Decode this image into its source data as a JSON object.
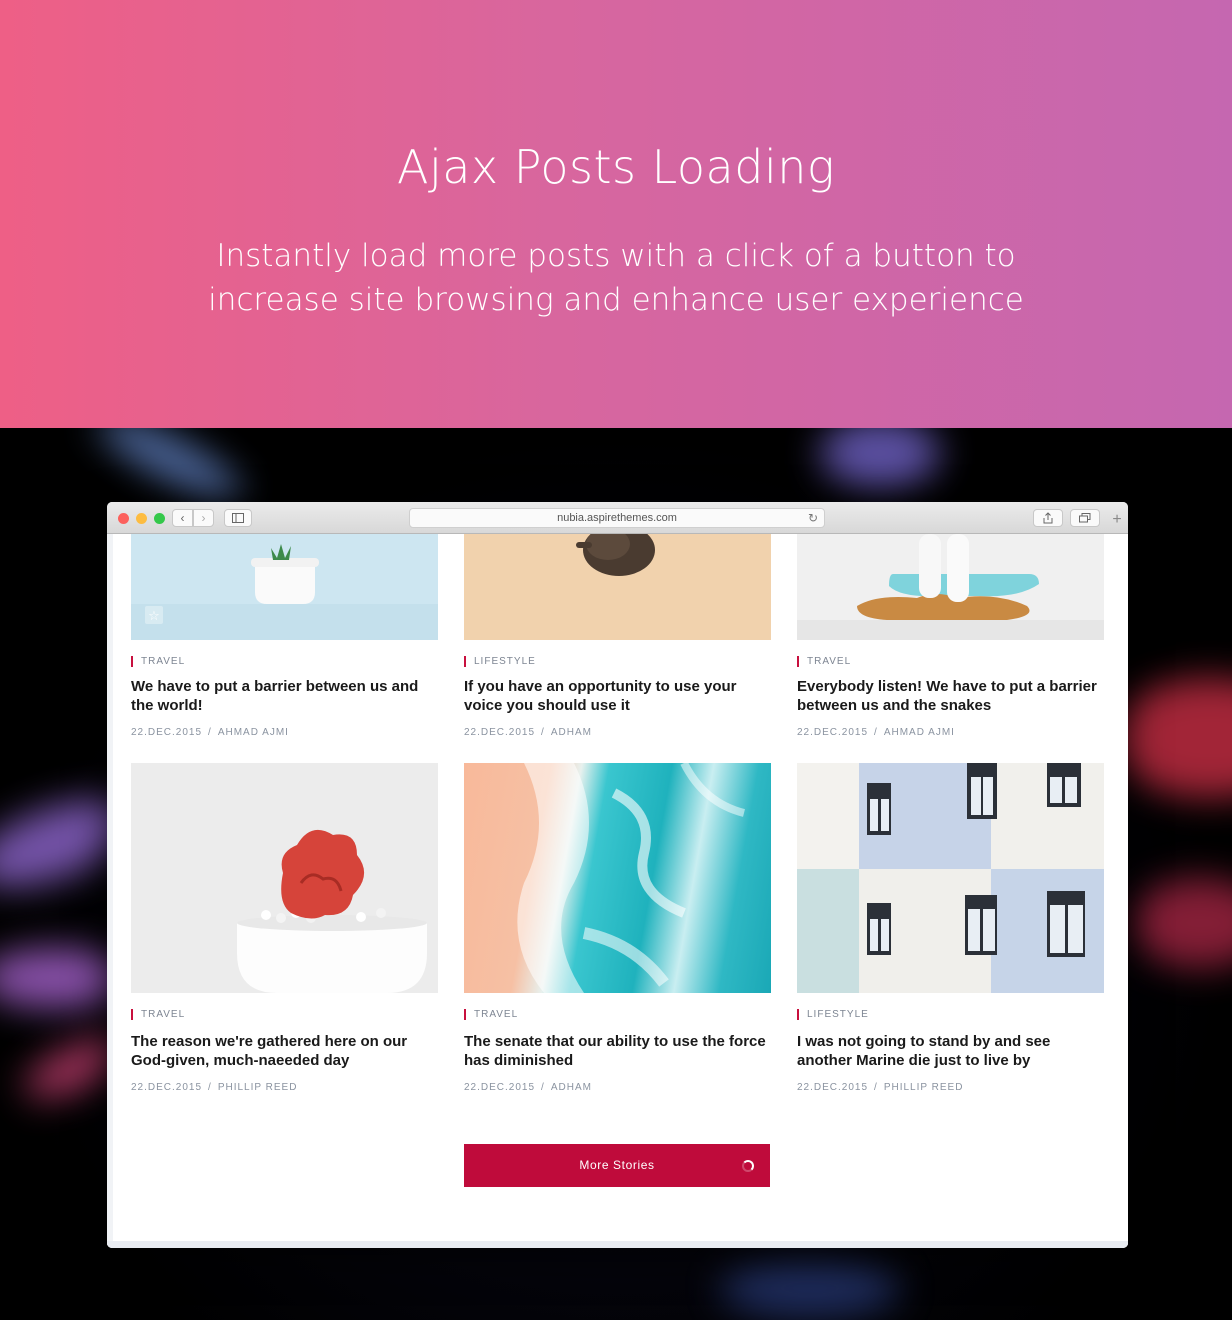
{
  "hero": {
    "title": "Ajax Posts Loading",
    "subtitle": "Instantly load more posts with a click of a button to increase site browsing and enhance user experience"
  },
  "browser": {
    "url": "nubia.aspirethemes.com"
  },
  "posts": [
    {
      "category": "TRAVEL",
      "title": "We have to put a barrier between us and the world!",
      "date": "22.DEC.2015",
      "author": "AHMAD AJMI"
    },
    {
      "category": "LIFESTYLE",
      "title": "If you have an opportunity to use your voice you should use it",
      "date": "22.DEC.2015",
      "author": "ADHAM"
    },
    {
      "category": "TRAVEL",
      "title": "Everybody listen! We have to put a barrier between us and the snakes",
      "date": "22.DEC.2015",
      "author": "AHMAD AJMI"
    },
    {
      "category": "TRAVEL",
      "title": "The reason we're gathered here on our God-given, much-naeeded day",
      "date": "22.DEC.2015",
      "author": "PHILLIP REED"
    },
    {
      "category": "TRAVEL",
      "title": "The senate that our ability to use the force has diminished",
      "date": "22.DEC.2015",
      "author": "ADHAM"
    },
    {
      "category": "LIFESTYLE",
      "title": "I was not going to stand by and see another Marine die just to live by",
      "date": "22.DEC.2015",
      "author": "PHILLIP REED"
    }
  ],
  "meta_separator": "/",
  "more_button": {
    "label": "More Stories"
  },
  "colors": {
    "accent": "#bf0b3b",
    "hero_start": "#ee5f86",
    "hero_end": "#c567b0"
  }
}
